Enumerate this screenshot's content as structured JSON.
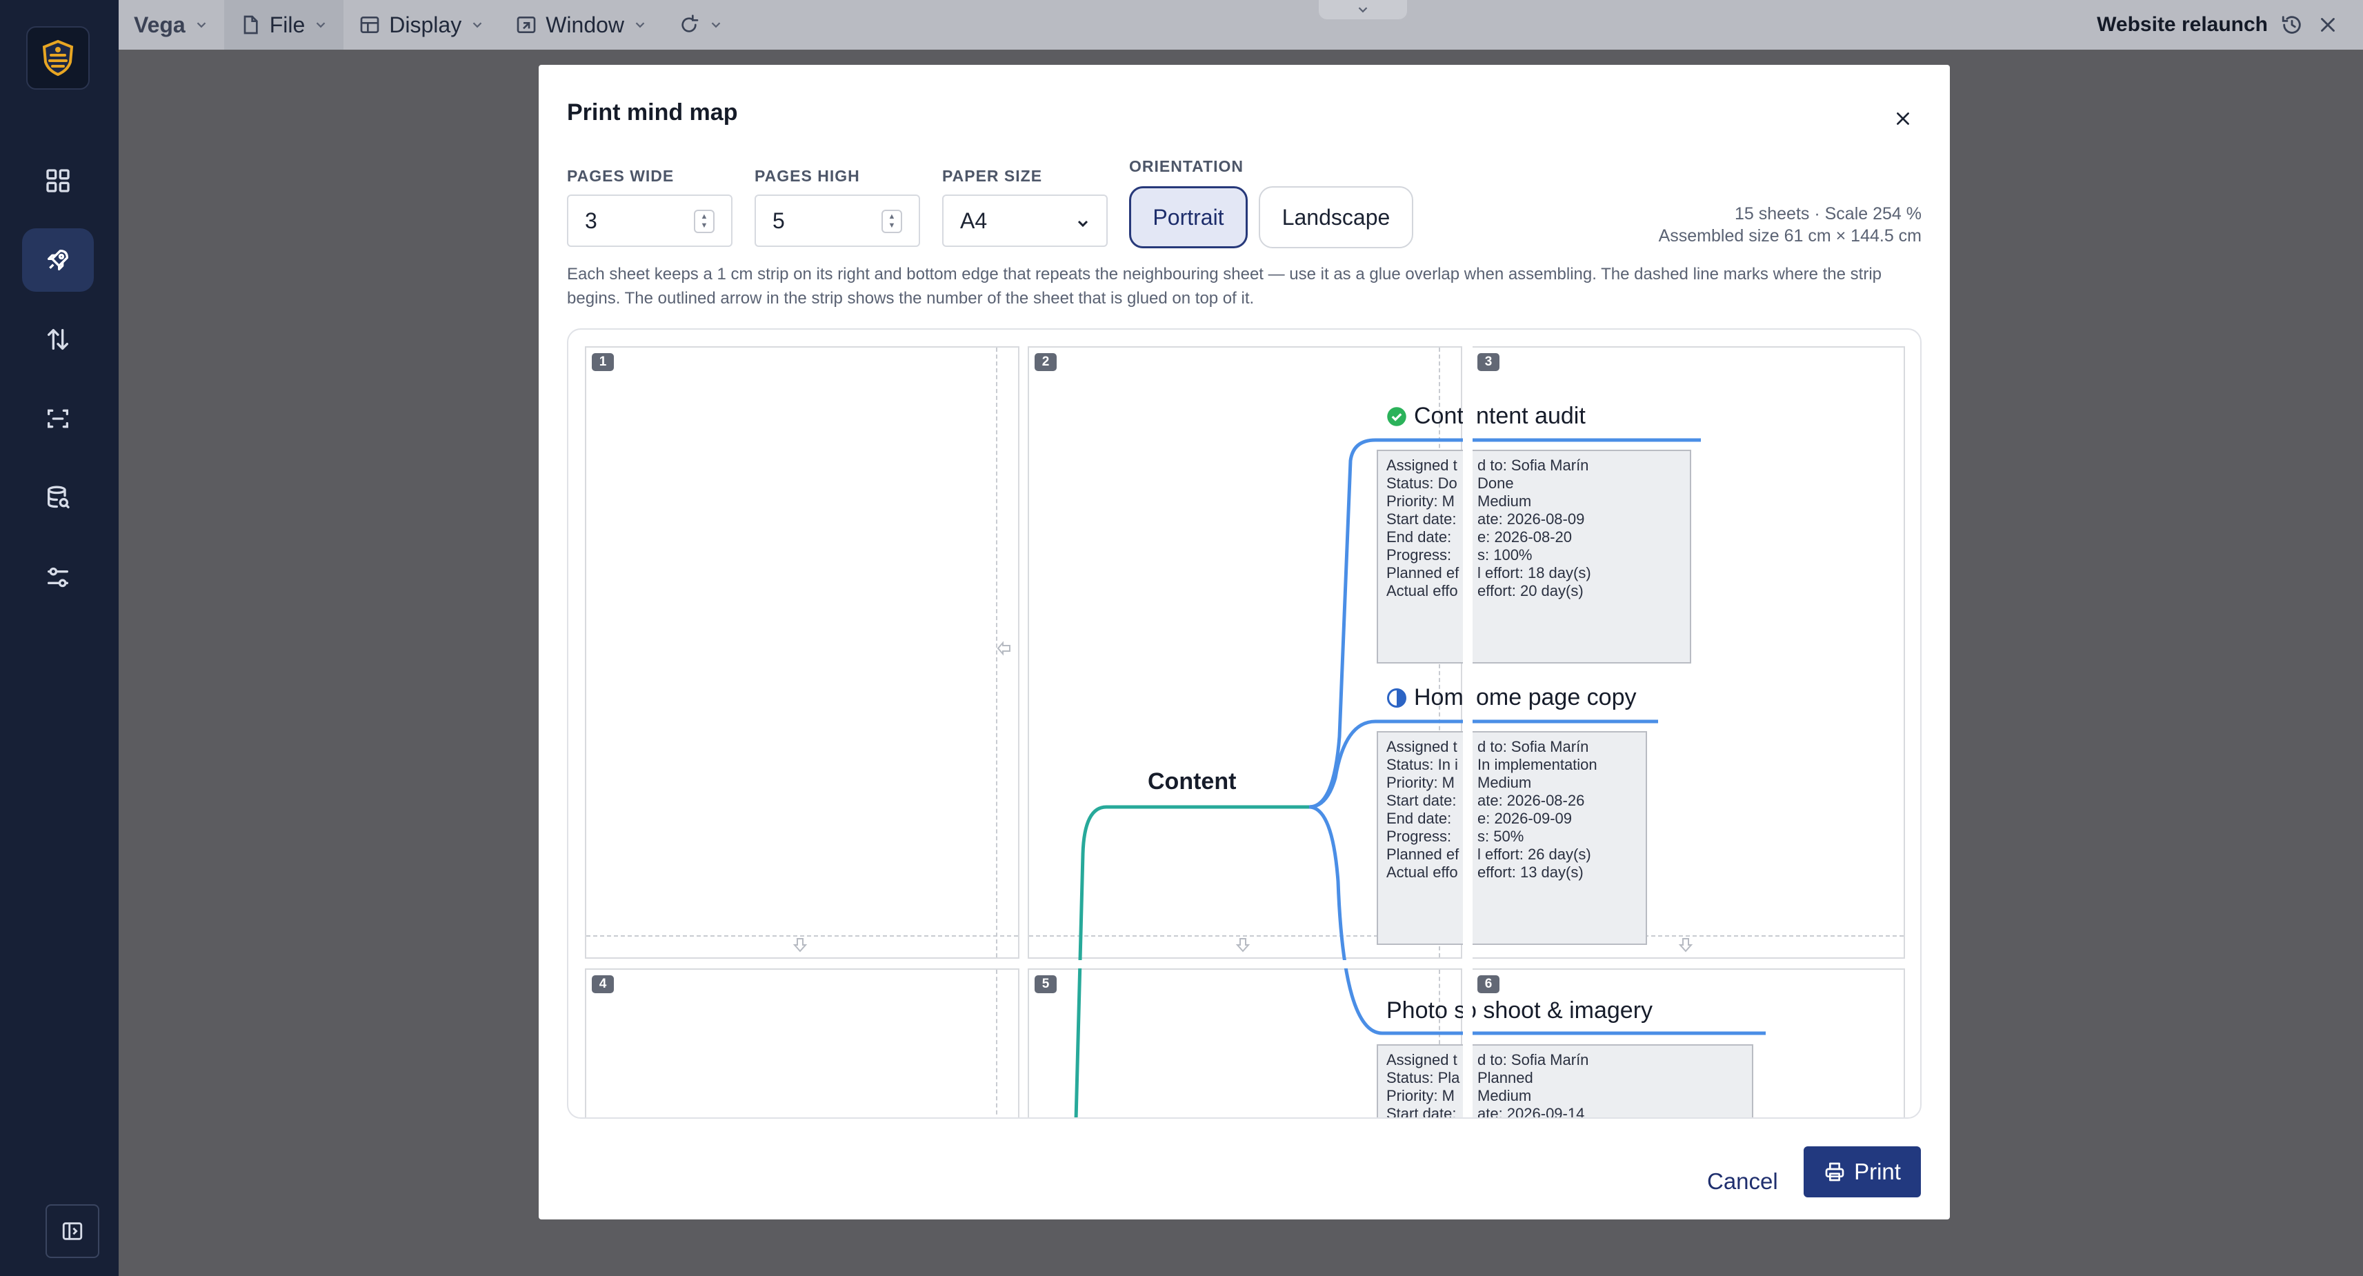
{
  "app": {
    "name": "Vega",
    "menus": [
      {
        "label": "File",
        "icon": "file-icon"
      },
      {
        "label": "Display",
        "icon": "grid-icon"
      },
      {
        "label": "Window",
        "icon": "window-icon"
      }
    ],
    "document_title": "Website relaunch"
  },
  "rail": {
    "items": [
      {
        "name": "dashboard-icon",
        "active": false
      },
      {
        "name": "rocket-icon",
        "active": true
      },
      {
        "name": "sort-arrows-icon",
        "active": false
      },
      {
        "name": "scan-icon",
        "active": false
      },
      {
        "name": "database-search-icon",
        "active": false
      },
      {
        "name": "sliders-icon",
        "active": false
      }
    ],
    "bottom": "sidebar-toggle-icon"
  },
  "dialog": {
    "title": "Print mind map",
    "pages_wide": {
      "label": "PAGES WIDE",
      "value": "3"
    },
    "pages_high": {
      "label": "PAGES HIGH",
      "value": "5"
    },
    "paper_size": {
      "label": "PAPER SIZE",
      "value": "A4"
    },
    "orientation": {
      "label": "ORIENTATION",
      "options": [
        "Portrait",
        "Landscape"
      ],
      "selected": "Portrait"
    },
    "stats_line1": "15 sheets · Scale 254 %",
    "stats_line2": "Assembled size 61 cm × 144.5 cm",
    "note": "Each sheet keeps a 1 cm strip on its right and bottom edge that repeats the neighbouring sheet — use it as a glue overlap when assembling. The dashed line marks where the strip begins. The outlined arrow in the strip shows the number of the sheet that is glued on top of it.",
    "cancel_label": "Cancel",
    "print_label": "Print"
  },
  "preview": {
    "sheets": [
      "1",
      "2",
      "3",
      "4",
      "5",
      "6"
    ],
    "root": "Content",
    "tasks": [
      {
        "title": "Content audit",
        "status_icon": "check-circle-icon",
        "left_part": "Cont",
        "right_part": "ntent audit",
        "details_left": [
          "Assigned t",
          "Status: Do",
          "Priority: M",
          "Start date:",
          "End date: ",
          "Progress: ",
          "Planned ef",
          "Actual effo"
        ],
        "details_right": [
          "d to: Sofia Marín",
          "Done",
          "Medium",
          "ate: 2026-08-09",
          "e: 2026-08-20",
          "s: 100%",
          "l effort: 18 day(s)",
          "effort: 20 day(s)"
        ]
      },
      {
        "title": "Home page copy",
        "status_icon": "half-circle-icon",
        "left_part": "Hom",
        "right_part": "ome page copy",
        "details_left": [
          "Assigned t",
          "Status: In i",
          "Priority: M",
          "Start date:",
          "End date: ",
          "Progress: ",
          "Planned ef",
          "Actual effo"
        ],
        "details_right": [
          "d to: Sofia Marín",
          "In implementation",
          "Medium",
          "ate: 2026-08-26",
          "e: 2026-09-09",
          "s: 50%",
          "l effort: 26 day(s)",
          "effort: 13 day(s)"
        ]
      },
      {
        "title": "Photo shoot & imagery",
        "status_icon": "",
        "left_part": "Photo s",
        "right_part": "o shoot & imagery",
        "details_left": [
          "Assigned t",
          "Status: Pla",
          "Priority: M",
          "Start date:"
        ],
        "details_right": [
          "d to: Sofia Marín",
          "Planned",
          "Medium",
          "ate: 2026-09-14"
        ]
      }
    ]
  },
  "colors": {
    "rail_bg": "#172036",
    "accent": "#22397f",
    "branch_blue": "#4a8ee6",
    "branch_teal": "#27a99a",
    "done_green": "#2bb25a"
  }
}
